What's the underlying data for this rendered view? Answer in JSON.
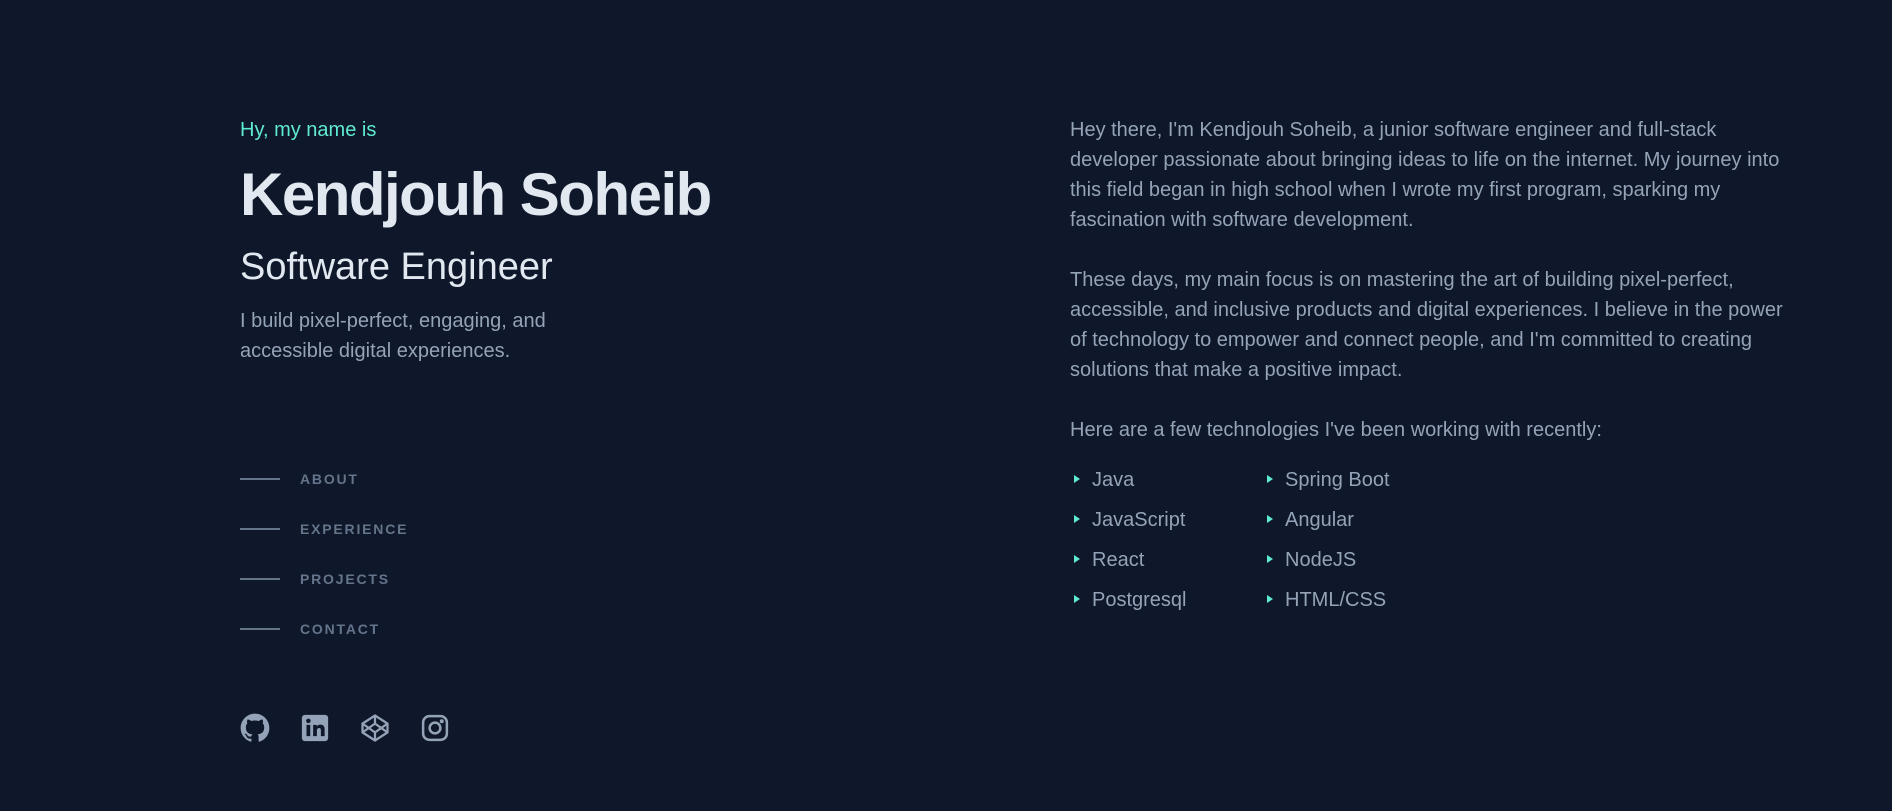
{
  "intro": {
    "greeting": "Hy, my name is",
    "name": "Kendjouh Soheib",
    "role": "Software Engineer",
    "tagline": "I build pixel-perfect, engaging, and accessible digital experiences."
  },
  "nav": {
    "items": [
      {
        "label": "ABOUT"
      },
      {
        "label": "EXPERIENCE"
      },
      {
        "label": "PROJECTS"
      },
      {
        "label": "CONTACT"
      }
    ]
  },
  "socials": {
    "icons": [
      "github-icon",
      "linkedin-icon",
      "codepen-icon",
      "instagram-icon"
    ]
  },
  "about": {
    "paragraph1": "Hey there, I'm Kendjouh Soheib, a junior software engineer and full-stack developer passionate about bringing ideas to life on the internet. My journey into this field began in high school when I wrote my first program, sparking my fascination with software development.",
    "paragraph2": "These days, my main focus is on mastering the art of building pixel-perfect, accessible, and inclusive products and digital experiences. I believe in the power of technology to empower and connect people, and I'm committed to creating solutions that make a positive impact.",
    "tech_intro": "Here are a few technologies I've been working with recently:",
    "technologies": [
      "Java",
      "Spring Boot",
      "JavaScript",
      "Angular",
      "React",
      "NodeJS",
      "Postgresql",
      "HTML/CSS"
    ]
  },
  "colors": {
    "background": "#0f172a",
    "accent": "#5eead4",
    "heading": "#e2e8f0",
    "body_text": "#94a3b8",
    "muted": "#64748b"
  }
}
